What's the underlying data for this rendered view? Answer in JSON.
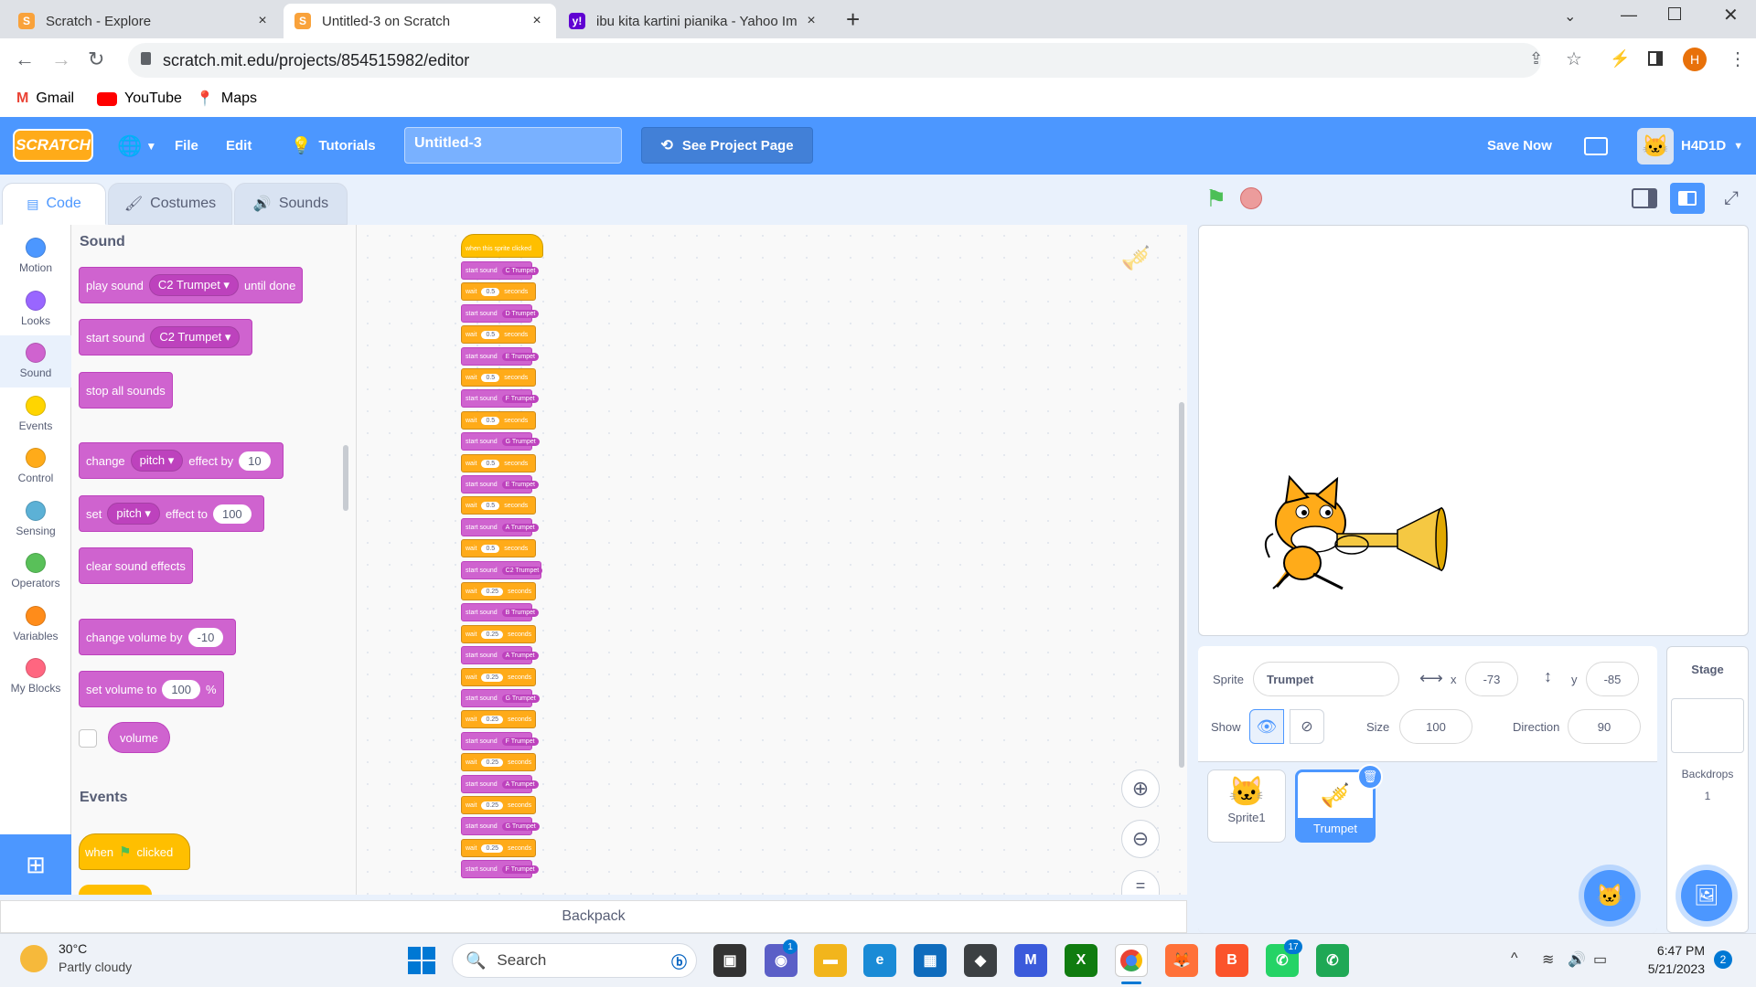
{
  "browser": {
    "tabs": [
      {
        "title": "Scratch - Explore",
        "close": "×"
      },
      {
        "title": "Untitled-3 on Scratch",
        "close": "×"
      },
      {
        "title": "ibu kita kartini pianika - Yahoo Im",
        "close": "×"
      }
    ],
    "new_tab": "+",
    "url": "scratch.mit.edu/projects/854515982/editor",
    "profile_initial": "H",
    "bookmarks": [
      "Gmail",
      "YouTube",
      "Maps"
    ]
  },
  "menubar": {
    "logo": "SCRATCH",
    "file": "File",
    "edit": "Edit",
    "tutorials": "Tutorials",
    "project_title": "Untitled-3",
    "see_project_page": "See Project Page",
    "save_now": "Save Now",
    "username": "H4D1D"
  },
  "editor_tabs": {
    "code": "Code",
    "costumes": "Costumes",
    "sounds": "Sounds"
  },
  "categories": [
    {
      "name": "Motion",
      "color": "#4c97ff"
    },
    {
      "name": "Looks",
      "color": "#9966ff"
    },
    {
      "name": "Sound",
      "color": "#cf63cf"
    },
    {
      "name": "Events",
      "color": "#ffd500"
    },
    {
      "name": "Control",
      "color": "#ffab19"
    },
    {
      "name": "Sensing",
      "color": "#5cb1d6"
    },
    {
      "name": "Operators",
      "color": "#59c059"
    },
    {
      "name": "Variables",
      "color": "#ff8c1a"
    },
    {
      "name": "My Blocks",
      "color": "#ff6680"
    }
  ],
  "palette": {
    "sound_heading": "Sound",
    "play_sound": {
      "label": "play sound",
      "sound": "C2 Trumpet",
      "suffix": "until done"
    },
    "start_sound": {
      "label": "start sound",
      "sound": "C2 Trumpet"
    },
    "stop_all": "stop all sounds",
    "change_effect": {
      "label": "change",
      "effect": "pitch",
      "mid": "effect by",
      "value": "10"
    },
    "set_effect": {
      "label": "set",
      "effect": "pitch",
      "mid": "effect to",
      "value": "100"
    },
    "clear_effects": "clear sound effects",
    "change_volume": {
      "label": "change volume by",
      "value": "-10"
    },
    "set_volume": {
      "label": "set volume to",
      "value": "100",
      "suffix": "%"
    },
    "volume": "volume",
    "events_heading": "Events",
    "when_flag": {
      "pre": "when",
      "post": "clicked"
    }
  },
  "script": {
    "hat": "when this sprite clicked",
    "start_label": "start sound",
    "wait_label": "wait",
    "seconds_label": "seconds",
    "steps": [
      {
        "sound": "C Trumpet",
        "wait": "0.5"
      },
      {
        "sound": "D Trumpet",
        "wait": "0.5"
      },
      {
        "sound": "E Trumpet",
        "wait": "0.5"
      },
      {
        "sound": "F Trumpet",
        "wait": "0.5"
      },
      {
        "sound": "G Trumpet",
        "wait": "0.5"
      },
      {
        "sound": "E Trumpet",
        "wait": "0.5"
      },
      {
        "sound": "A Trumpet",
        "wait": "0.5"
      },
      {
        "sound": "C2 Trumpet",
        "wait": "0.25"
      },
      {
        "sound": "B Trumpet",
        "wait": "0.25"
      },
      {
        "sound": "A Trumpet",
        "wait": "0.25"
      },
      {
        "sound": "G Trumpet",
        "wait": "0.25"
      },
      {
        "sound": "F Trumpet",
        "wait": "0.25"
      },
      {
        "sound": "A Trumpet",
        "wait": "0.25"
      },
      {
        "sound": "G Trumpet",
        "wait": "0.25"
      },
      {
        "sound": "F Trumpet",
        "wait": null
      }
    ]
  },
  "backpack": "Backpack",
  "sprite_info": {
    "sprite_label": "Sprite",
    "sprite_name": "Trumpet",
    "x_label": "x",
    "x": "-73",
    "y_label": "y",
    "y": "-85",
    "show_label": "Show",
    "size_label": "Size",
    "size": "100",
    "direction_label": "Direction",
    "direction": "90"
  },
  "sprites": [
    {
      "name": "Sprite1",
      "selected": false
    },
    {
      "name": "Trumpet",
      "selected": true
    }
  ],
  "stage_pane": {
    "title": "Stage",
    "backdrops_label": "Backdrops",
    "backdrops_count": "1"
  },
  "taskbar": {
    "temperature": "30°C",
    "weather": "Partly cloudy",
    "search": "Search",
    "time": "6:47 PM",
    "date": "5/21/2023",
    "notif_count": "2",
    "badge_teams": "1",
    "badge_whatsapp": "17"
  }
}
